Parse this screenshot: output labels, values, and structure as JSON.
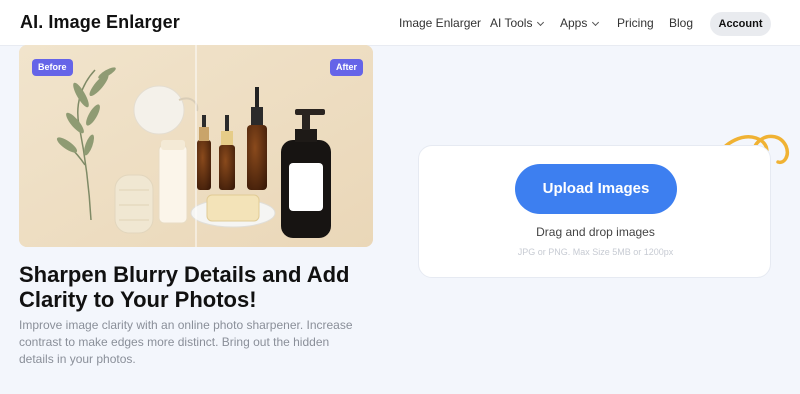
{
  "header": {
    "logo": "AI. Image Enlarger",
    "nav": [
      {
        "label": "Image Enlarger",
        "dropdown": false
      },
      {
        "label": "AI Tools",
        "dropdown": true
      },
      {
        "label": "Apps",
        "dropdown": true
      },
      {
        "label": "Pricing",
        "dropdown": false
      },
      {
        "label": "Blog",
        "dropdown": false
      }
    ],
    "account_label": "Account"
  },
  "hero": {
    "before_label": "Before",
    "after_label": "After"
  },
  "main": {
    "headline": "Sharpen Blurry Details and Add Clarity to Your Photos!",
    "description": "Improve image clarity with an online photo sharpener. Increase contrast to make edges more distinct. Bring out the hidden details in your photos."
  },
  "upload": {
    "button_label": "Upload Images",
    "drag_text": "Drag and drop images",
    "limits_text": "JPG or PNG. Max Size 5MB or 1200px"
  },
  "colors": {
    "primary": "#3d7ff0",
    "badge": "#6564e8",
    "arrow": "#f0b233",
    "background": "#f3f6fc"
  }
}
